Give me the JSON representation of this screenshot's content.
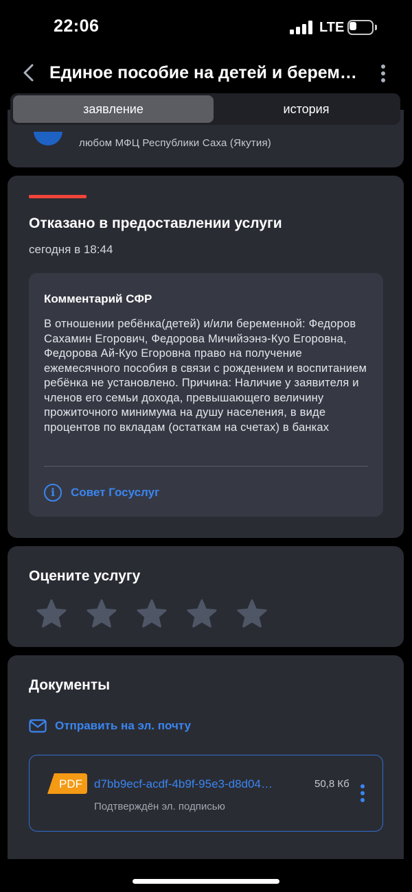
{
  "status_bar": {
    "time": "22:06",
    "network": "LTE",
    "battery_level": 0.25
  },
  "header": {
    "title": "Единое пособие на детей и беременным",
    "back_icon": "chevron-left-icon",
    "more_icon": "more-vertical-icon"
  },
  "tabs": [
    {
      "label": "заявление",
      "active": true
    },
    {
      "label": "история",
      "active": false
    }
  ],
  "mfc_card": {
    "text": "любом МФЦ Республики Саха (Якутия)"
  },
  "status_card": {
    "title": "Отказано в предоставлении услуги",
    "date": "сегодня в 18:44",
    "accent_color": "#f0453a",
    "comment": {
      "title": "Комментарий СФР",
      "text": "В отношении ребёнка(детей) и/или беременной: Федоров Сахамин Егорович, Федорова Мичийээнэ-Куо Егоровна, Федорова Ай-Куо Егоровна право на получение ежемесячного пособия в связи с рождением и воспитанием ребёнка не установлено. Причина: Наличие у заявителя и членов его семьи дохода, превышающего величину прожиточного минимума на душу населения, в виде процентов по вкладам (остаткам на счетах) в банках"
    },
    "advice_link": "Совет Госуслуг"
  },
  "rating_card": {
    "title": "Оцените услугу",
    "max_stars": 5,
    "selected_stars": 0
  },
  "documents_card": {
    "title": "Документы",
    "email_link": "Отправить на эл. почту",
    "documents": [
      {
        "type": "PDF",
        "name": "d7bb9ecf-acdf-4b9f-95e3-d8d04…",
        "size": "50,8 Кб",
        "signature": "Подтверждён эл. подписью"
      }
    ]
  },
  "colors": {
    "background": "#000000",
    "card": "#2a2c34",
    "accent_blue": "#3a86f1",
    "pdf_badge": "#f59a14",
    "star": "#4f5666"
  }
}
